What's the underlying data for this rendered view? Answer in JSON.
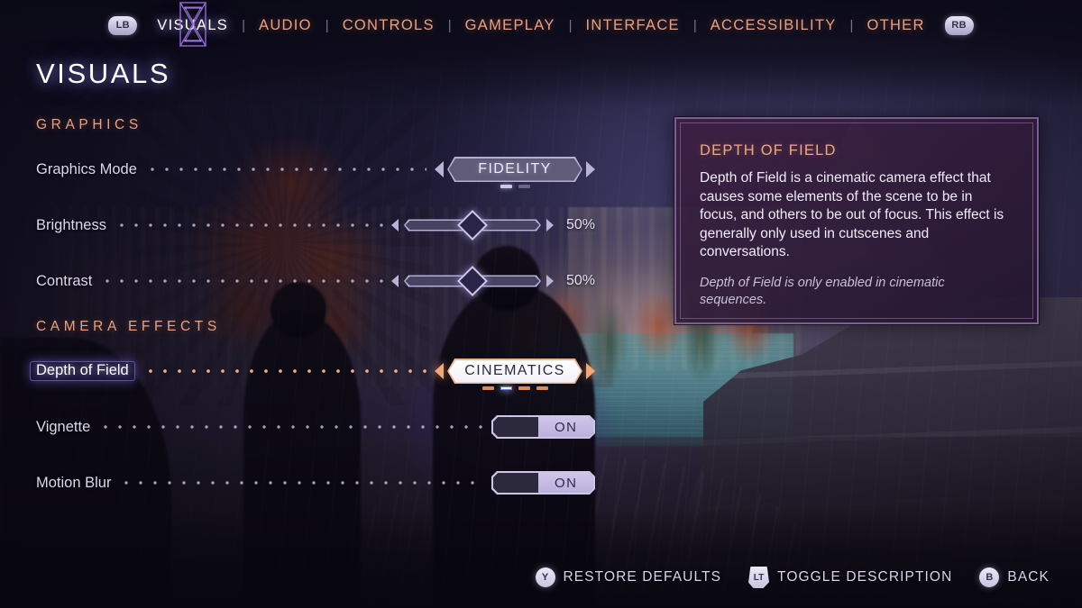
{
  "topnav": {
    "left_bumper": "LB",
    "right_bumper": "RB",
    "separator": "|",
    "emblem_icon": "hourglass-emblem-icon",
    "items": [
      {
        "label": "VISUALS",
        "active": true
      },
      {
        "label": "AUDIO",
        "active": false
      },
      {
        "label": "CONTROLS",
        "active": false
      },
      {
        "label": "GAMEPLAY",
        "active": false
      },
      {
        "label": "INTERFACE",
        "active": false
      },
      {
        "label": "ACCESSIBILITY",
        "active": false
      },
      {
        "label": "OTHER",
        "active": false
      }
    ]
  },
  "page": {
    "title": "VISUALS"
  },
  "sections": [
    {
      "header": "GRAPHICS",
      "rows": [
        {
          "label": "Graphics Mode",
          "type": "selector",
          "value": "FIDELITY",
          "selected": false,
          "pages": 2,
          "page_index": 0
        },
        {
          "label": "Brightness",
          "type": "slider",
          "value": "50%",
          "percent": 50,
          "selected": false
        },
        {
          "label": "Contrast",
          "type": "slider",
          "value": "50%",
          "percent": 50,
          "selected": false
        }
      ]
    },
    {
      "header": "CAMERA EFFECTS",
      "rows": [
        {
          "label": "Depth of Field",
          "type": "selector",
          "value": "CINEMATICS",
          "selected": true,
          "pages": 4,
          "page_index": 1
        },
        {
          "label": "Vignette",
          "type": "toggle",
          "value": "ON",
          "state": "on",
          "selected": false
        },
        {
          "label": "Motion Blur",
          "type": "toggle",
          "value": "ON",
          "state": "on",
          "selected": false
        }
      ]
    }
  ],
  "description": {
    "title": "DEPTH OF FIELD",
    "body": "Depth of Field is a cinematic camera effect that causes some elements of the scene to be in focus, and others to be out of focus. This effect is generally only used in cutscenes and conversations.",
    "note": "Depth of Field is only enabled in cinematic sequences."
  },
  "prompts": [
    {
      "button": "Y",
      "glyph_icon": "button-y-icon",
      "label": "RESTORE DEFAULTS",
      "kind": "round"
    },
    {
      "button": "LT",
      "glyph_icon": "trigger-lt-icon",
      "label": "TOGGLE DESCRIPTION",
      "kind": "trigger"
    },
    {
      "button": "B",
      "glyph_icon": "button-b-icon",
      "label": "BACK",
      "kind": "round"
    }
  ],
  "colors": {
    "accent_orange": "#ec9f7d",
    "active_white": "#ffffff",
    "label_lavender": "#ddd8ee",
    "panel_border": "#7b5f93",
    "highlight_purple": "#8a6ef0"
  }
}
